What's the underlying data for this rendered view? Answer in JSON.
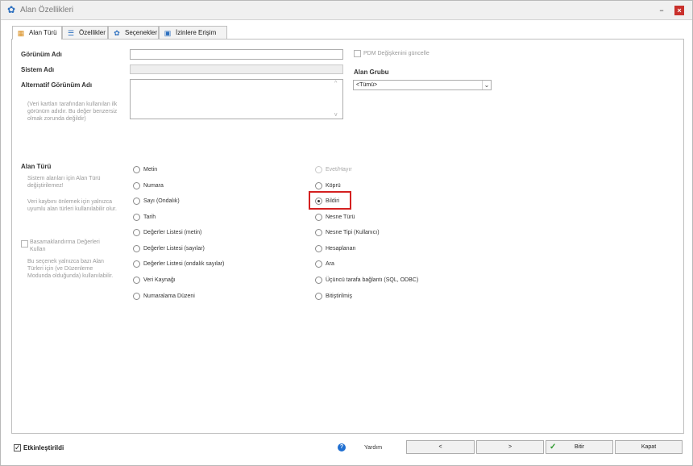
{
  "window": {
    "title": "Alan Özellikleri",
    "minimize": "−",
    "close": "×"
  },
  "tabs": [
    {
      "label": "Alan Türü",
      "icon": "table-icon"
    },
    {
      "label": "Özellikler",
      "icon": "list-icon"
    },
    {
      "label": "Seçenekler",
      "icon": "gear-icon"
    },
    {
      "label": "İzinlere Erişim",
      "icon": "lock-icon"
    }
  ],
  "form": {
    "display_name_label": "Görünüm Adı",
    "display_name_value": "",
    "system_name_label": "Sistem Adı",
    "system_name_value": "",
    "alt_name_label": "Alternatif Görünüm Adı",
    "alt_name_note": "(Veri kartları tarafından kullanılan ilk görünüm adıdır. Bu değer benzersiz olmak zorunda değildir)",
    "alt_name_value": "",
    "pdm_update_label": "PDM Değişkenini güncelle",
    "pdm_update_checked": false,
    "field_group_label": "Alan Grubu",
    "field_group_value": "<Tümü>"
  },
  "field_type": {
    "label": "Alan Türü",
    "note1": "Sistem alanları için Alan Türü değiştirilemez!",
    "note2": "Veri kaybını önlemek için yalnızca uyumlu alan türleri kullanılabilir olur.",
    "cascade_label": "Basamaklandırma Değerleri Kullan",
    "cascade_checked": false,
    "cascade_note": "Bu seçenek yalnızca bazı Alan Türleri için (ve Düzenleme Modunda olduğunda) kullanılabilir.",
    "selected": "Bildiri",
    "left_options": [
      "Metin",
      "Numara",
      "Sayı (Ondalık)",
      "Tarih",
      "Değerler Listesi (metin)",
      "Değerler Listesi (sayılar)",
      "Değerler Listesi (ondalık sayılar)",
      "Veri Kaynağı",
      "Numaralama Düzeni"
    ],
    "right_options": [
      "Evet/Hayır",
      "Köprü",
      "Bildiri",
      "Nesne Türü",
      "Nesne Tipi (Kullanıcı)",
      "Hesaplanan",
      "Ara",
      "Üçüncü tarafa bağlantı (SQL, ODBC)",
      "Bitiştirilmiş"
    ],
    "disabled_options": [
      "Evet/Hayır"
    ]
  },
  "footer": {
    "enabled_label": "Etkinleştirildi",
    "enabled_checked": true,
    "help_label": "Yardım",
    "prev_label": "<",
    "next_label": ">",
    "finish_label": "Bitir",
    "close_label": "Kapat"
  }
}
